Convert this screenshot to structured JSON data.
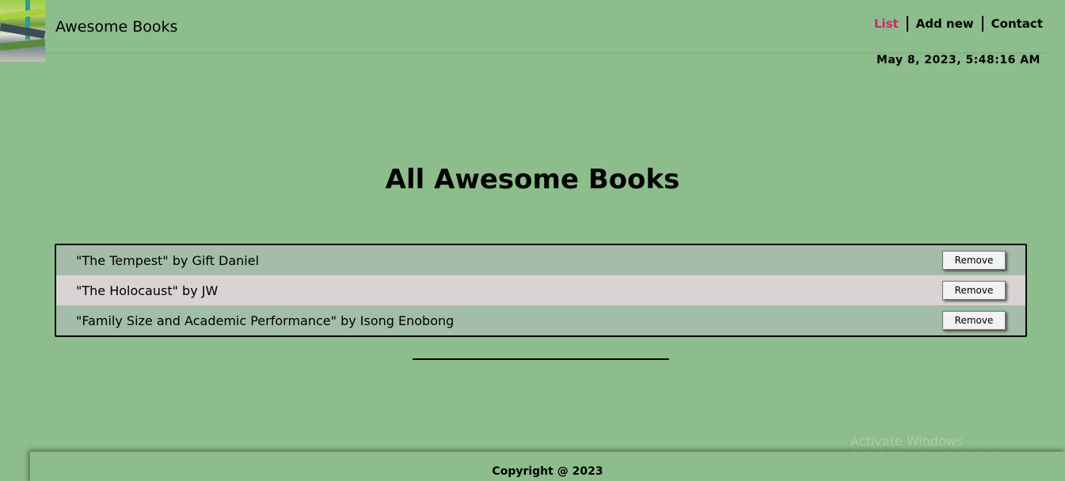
{
  "header": {
    "brand": "Awesome Books",
    "nav": [
      {
        "label": "List",
        "active": true
      },
      {
        "label": "Add new",
        "active": false
      },
      {
        "label": "Contact",
        "active": false
      }
    ],
    "datetime": "May 8, 2023, 5:48:16 AM"
  },
  "main": {
    "heading": "All Awesome Books",
    "books": [
      {
        "text": "\"The Tempest\" by Gift Daniel",
        "button": "Remove"
      },
      {
        "text": "\"The Holocaust\" by JW",
        "button": "Remove"
      },
      {
        "text": "\"Family Size and Academic Performance\" by Isong Enobong",
        "button": "Remove"
      }
    ]
  },
  "footer": {
    "copyright": "Copyright @ 2023"
  },
  "watermark": {
    "title": "Activate Windows",
    "subtitle": "Go to Settings to activate Windows."
  },
  "colors": {
    "background": "#8dbd8c",
    "active_nav": "#c22d6f",
    "row_odd": "#a3bda8",
    "row_even": "#d8d4d4"
  }
}
